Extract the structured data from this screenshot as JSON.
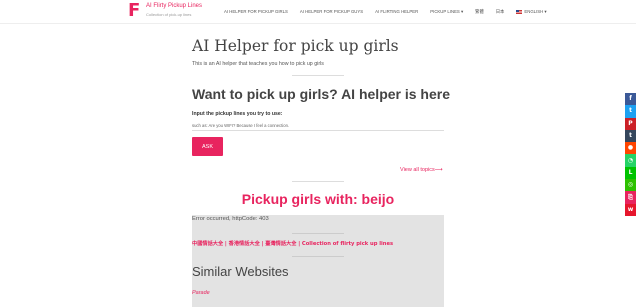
{
  "header": {
    "logo_letter": "F",
    "site_name": "AI Flirty Pickup Lines",
    "tagline": "Collection of pick-up lines",
    "nav": [
      {
        "label": "AI HELPER FOR PICKUP GIRLS"
      },
      {
        "label": "AI HELPER FOR PICKUP GUYS"
      },
      {
        "label": "AI FLIRTING HELPER"
      },
      {
        "label": "PICKUP LINES ▾"
      },
      {
        "label": "繁體"
      },
      {
        "label": "日本"
      },
      {
        "label": "ENGLISH ▾"
      }
    ]
  },
  "main": {
    "title": "AI Helper for pick up girls",
    "subtitle": "This is an AI helper that teaches you how to pick up girls",
    "form_heading": "Want to pick up girls? AI helper is here",
    "input_label": "Input the pickup lines you try to use:",
    "input_placeholder": "such as: Are you WIFI? Because I feel a connection.",
    "ask_label": "ASK",
    "view_topics": "View all topics⟶",
    "result_heading": "Pickup girls with: beijo",
    "error_text": "Error occurred, httpCode: 403",
    "pickup_collection_link": "中國情話大全 | 香港情話大全 | 臺灣情話大全 | Collection of flirty pick up lines",
    "similar_heading": "Similar Websites",
    "similar_items": [
      {
        "label": "Parade"
      }
    ]
  },
  "share_bar": [
    {
      "icon": "facebook-icon",
      "glyph": "f",
      "color": "#3b5998"
    },
    {
      "icon": "twitter-icon",
      "glyph": "t",
      "color": "#1da1f2"
    },
    {
      "icon": "pinterest-icon",
      "glyph": "P",
      "color": "#cb2027"
    },
    {
      "icon": "tumblr-icon",
      "glyph": "t",
      "color": "#35465c"
    },
    {
      "icon": "reddit-icon",
      "glyph": "●",
      "color": "#ff4500"
    },
    {
      "icon": "whatsapp-icon",
      "glyph": "◔",
      "color": "#25d366"
    },
    {
      "icon": "line-icon",
      "glyph": "L",
      "color": "#00c300"
    },
    {
      "icon": "wechat-icon",
      "glyph": "◎",
      "color": "#2dc100"
    },
    {
      "icon": "copy-link-icon",
      "glyph": "⎘",
      "color": "#e8245f"
    },
    {
      "icon": "weibo-icon",
      "glyph": "w",
      "color": "#e6162d"
    }
  ],
  "colors": {
    "accent": "#e8245f",
    "grey_panel": "#e3e3e3"
  }
}
